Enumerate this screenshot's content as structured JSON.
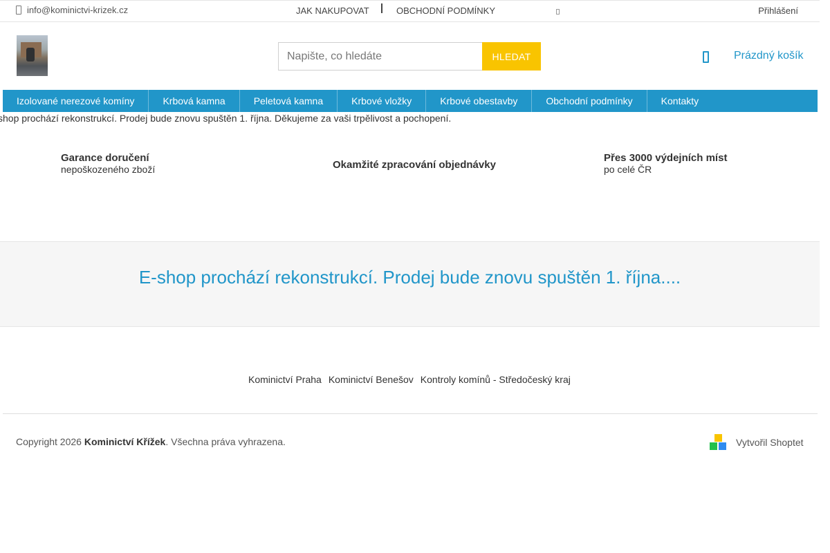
{
  "topbar": {
    "email": "info@kominictvi-krizek.cz",
    "link_how_to_buy": "JAK NAKUPOVAT",
    "link_terms": "OBCHODNÍ PODMÍNKY",
    "login": "Přihlášení"
  },
  "search": {
    "placeholder": "Napište, co hledáte",
    "button_label": "HLEDAT"
  },
  "cart": {
    "label": "Prázdný košík"
  },
  "menu": {
    "items": [
      "Izolované nerezové komíny",
      "Krbová kamna",
      "Peletová kamna",
      "Krbové vložky",
      "Krbové obestavby",
      "Obchodní podmínky",
      "Kontakty"
    ]
  },
  "notice": "shop prochází rekonstrukcí. Prodej bude znovu spuštěn 1. října. Děkujeme za vaši trpělivost a pochopení.",
  "benefits": [
    {
      "title": "Garance doručení",
      "subtitle": "nepoškozeného zboží"
    },
    {
      "title": "Okamžité zpracování objednávky",
      "subtitle": ""
    },
    {
      "title": "Přes 3000 výdejních míst",
      "subtitle": "po celé ČR"
    }
  ],
  "banner": {
    "text": "E-shop prochází rekonstrukcí. Prodej bude znovu spuštěn 1. října...."
  },
  "footer": {
    "links": [
      "Kominictví Praha",
      "Kominictví Benešov",
      "Kontroly komínů - Středočeský kraj"
    ],
    "copyright_prefix": "Copyright 2026 ",
    "copyright_brand": "Kominictví Křížek",
    "copyright_suffix": ". Všechna práva vyhrazena.",
    "made_by": "Vytvořil Shoptet"
  },
  "colors": {
    "accent_blue": "#2196c9",
    "search_button_yellow": "#f9c400"
  }
}
